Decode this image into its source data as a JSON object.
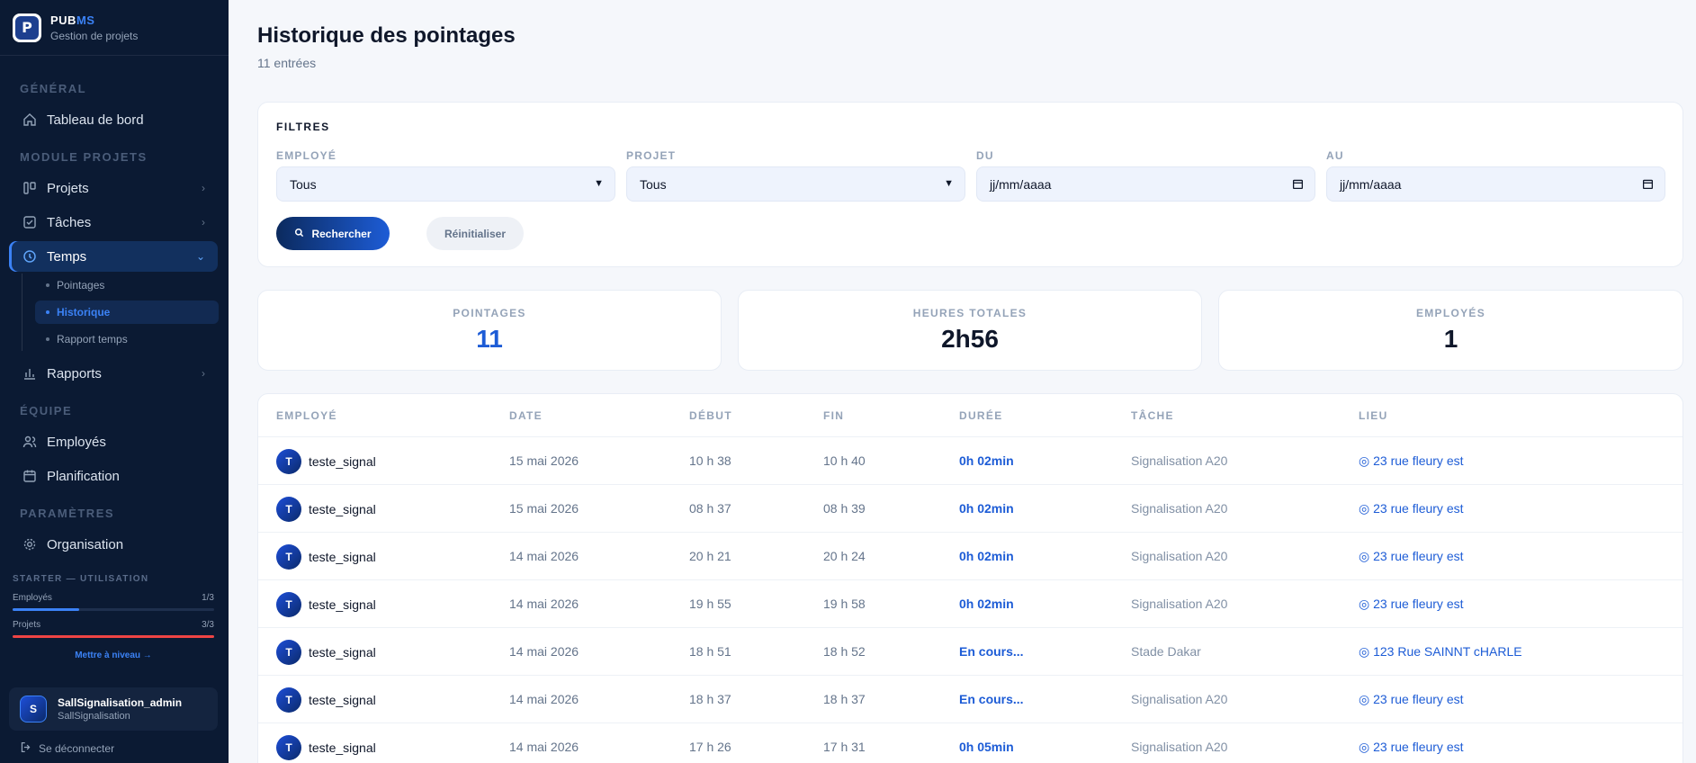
{
  "brand": {
    "logo_letter": "P",
    "name_a": "PUB",
    "name_b": "MS",
    "subtitle": "Gestion de projets"
  },
  "sidebar": {
    "section_general": "GÉNÉRAL",
    "dashboard": "Tableau de bord",
    "section_projects": "MODULE PROJETS",
    "projects": "Projets",
    "tasks": "Tâches",
    "time": "Temps",
    "time_sub": [
      "Pointages",
      "Historique",
      "Rapport temps"
    ],
    "reports": "Rapports",
    "section_team": "ÉQUIPE",
    "employees": "Employés",
    "planning": "Planification",
    "section_settings": "PARAMÈTRES",
    "organization": "Organisation"
  },
  "usage": {
    "title": "STARTER — UTILISATION",
    "employees_label": "Employés",
    "employees_count": "1/3",
    "employees_fraction": 0.33,
    "projects_label": "Projets",
    "projects_count": "3/3",
    "projects_fraction": 1.0,
    "upgrade": "Mettre à niveau →"
  },
  "user": {
    "initial": "S",
    "name": "SallSignalisation_admin",
    "org": "SallSignalisation",
    "logout": "Se déconnecter"
  },
  "page": {
    "title": "Historique des pointages",
    "subtitle": "11 entrées"
  },
  "filters": {
    "title": "FILTRES",
    "employee_label": "EMPLOYÉ",
    "employee_value": "Tous",
    "project_label": "PROJET",
    "project_value": "Tous",
    "from_label": "DU",
    "from_value": "jj/mm/aaaa",
    "to_label": "AU",
    "to_value": "jj/mm/aaaa",
    "search_button": "Rechercher",
    "reset_button": "Réinitialiser"
  },
  "stats": [
    {
      "label": "POINTAGES",
      "value": "11"
    },
    {
      "label": "HEURES TOTALES",
      "value": "2h56"
    },
    {
      "label": "EMPLOYÉS",
      "value": "1"
    }
  ],
  "table": {
    "headers": [
      "EMPLOYÉ",
      "DATE",
      "DÉBUT",
      "FIN",
      "DURÉE",
      "TÂCHE",
      "LIEU"
    ],
    "rows": [
      {
        "initial": "T",
        "employee": "teste_signal",
        "date": "15 mai 2026",
        "start": "10 h 38",
        "end": "10 h 40",
        "duration": "0h 02min",
        "task": "Signalisation A20",
        "location": "◎ 23 rue fleury est"
      },
      {
        "initial": "T",
        "employee": "teste_signal",
        "date": "15 mai 2026",
        "start": "08 h 37",
        "end": "08 h 39",
        "duration": "0h 02min",
        "task": "Signalisation A20",
        "location": "◎ 23 rue fleury est"
      },
      {
        "initial": "T",
        "employee": "teste_signal",
        "date": "14 mai 2026",
        "start": "20 h 21",
        "end": "20 h 24",
        "duration": "0h 02min",
        "task": "Signalisation A20",
        "location": "◎ 23 rue fleury est"
      },
      {
        "initial": "T",
        "employee": "teste_signal",
        "date": "14 mai 2026",
        "start": "19 h 55",
        "end": "19 h 58",
        "duration": "0h 02min",
        "task": "Signalisation A20",
        "location": "◎ 23 rue fleury est"
      },
      {
        "initial": "T",
        "employee": "teste_signal",
        "date": "14 mai 2026",
        "start": "18 h 51",
        "end": "18 h 52",
        "duration": "En cours...",
        "task": "Stade Dakar",
        "location": "◎ 123 Rue SAINNT cHARLE"
      },
      {
        "initial": "T",
        "employee": "teste_signal",
        "date": "14 mai 2026",
        "start": "18 h 37",
        "end": "18 h 37",
        "duration": "En cours...",
        "task": "Signalisation A20",
        "location": "◎ 23 rue fleury est"
      },
      {
        "initial": "T",
        "employee": "teste_signal",
        "date": "14 mai 2026",
        "start": "17 h 26",
        "end": "17 h 31",
        "duration": "0h 05min",
        "task": "Signalisation A20",
        "location": "◎ 23 rue fleury est"
      }
    ]
  },
  "colors": {
    "sidebar_bg": "#0b1a33",
    "accent": "#1d5cd6",
    "usage_projects": "#ef4444",
    "usage_employees": "#3b82f6"
  }
}
